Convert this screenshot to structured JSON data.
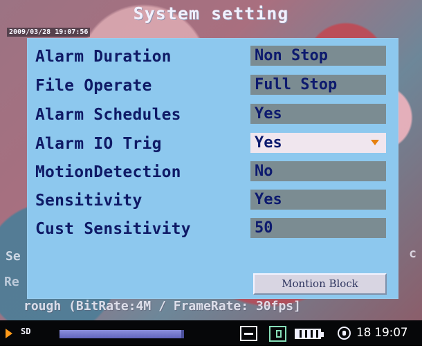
{
  "screen": {
    "title": "System setting",
    "timestamp": "2009/03/28 19:07:56",
    "left_text_1": "Se",
    "left_text_2": "Re",
    "right_text": "c",
    "stream_info": "rough (BitRate:4M / FrameRate: 30fps]"
  },
  "settings": {
    "rows": [
      {
        "label": "Alarm Duration",
        "value": "Non Stop"
      },
      {
        "label": "File Operate",
        "value": "Full Stop"
      },
      {
        "label": "Alarm Schedules",
        "value": "Yes"
      },
      {
        "label": "Alarm IO Trig",
        "value": "Yes"
      },
      {
        "label": "MotionDetection",
        "value": "No"
      },
      {
        "label": "Sensitivity",
        "value": "Yes"
      },
      {
        "label": "Cust Sensitivity",
        "value": "50"
      }
    ],
    "motion_block_label": "Montion Block"
  },
  "status_bar": {
    "storage_label": "SD",
    "progress_fraction": 0.98,
    "time": "18 19:07",
    "icons": [
      "play-icon",
      "minus-icon",
      "card-icon",
      "battery-icon",
      "lock-icon"
    ]
  },
  "colors": {
    "panel": "#8dc8ee",
    "field": "#7b8c92",
    "active_field": "#f0e6ee",
    "accent": "#e6800f",
    "status_bar": "#060709"
  }
}
